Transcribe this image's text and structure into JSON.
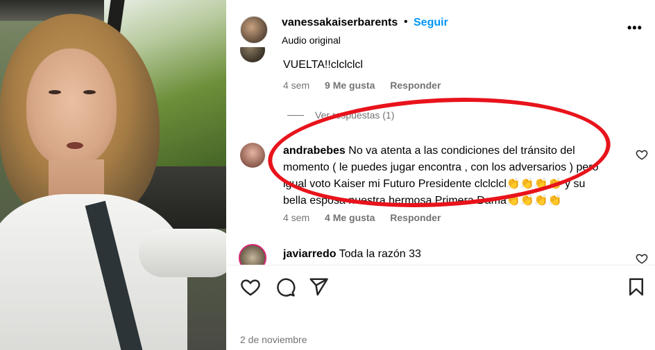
{
  "post": {
    "username": "vanessakaiserbarents",
    "dot": "•",
    "follow_label": "Seguir",
    "audio": "Audio original",
    "more_label": "•••",
    "date": "2 de noviembre"
  },
  "comments": {
    "partial": {
      "text": "VUELTA!!clclclcl",
      "time": "4 sem",
      "likes": "9 Me gusta",
      "reply": "Responder",
      "view_replies": "Ver respuestas (1)"
    },
    "c2": {
      "user": "andrabebes",
      "text": "No va atenta a las condiciones del tránsito del momento ( le puedes jugar encontra , con los adversarios ) pero igual voto Kaiser mi Futuro Presidente clclclcl👏👏👏👏 y su bella esposa nuestra hermosa Primera Dama👏👏👏👏",
      "time": "4 sem",
      "likes": "4 Me gusta",
      "reply": "Responder"
    },
    "c3": {
      "user": "javiarredo",
      "text": "Toda la razón 33"
    }
  },
  "icons": {
    "like": "heart-icon",
    "comment": "comment-icon",
    "share": "paper-plane-icon",
    "save": "bookmark-icon",
    "more": "more-icon"
  },
  "colors": {
    "accent": "#0095f6",
    "secondary_text": "#737373",
    "annotation": "#e8131b",
    "story_ring": "#d62976"
  }
}
